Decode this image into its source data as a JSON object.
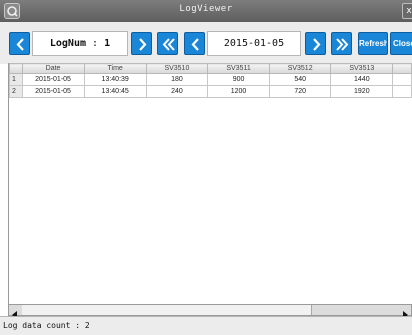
{
  "window": {
    "title": "LogViewer",
    "close_glyph": "x",
    "app_icon": "q-icon"
  },
  "toolbar": {
    "lognum_label": "LogNum",
    "lognum_sep": ":",
    "lognum_value": "1",
    "date_value": "2015-01-05",
    "refresh_label": "Refresh",
    "close_label": "Close",
    "accent_color": "#1a86d8"
  },
  "grid": {
    "columns": [
      "Date",
      "Time",
      "SV3510",
      "SV3511",
      "SV3512",
      "SV3513"
    ],
    "rows": [
      {
        "num": "1",
        "cells": [
          "2015-01-05",
          "13:40:39",
          "180",
          "900",
          "540",
          "1440"
        ]
      },
      {
        "num": "2",
        "cells": [
          "2015-01-05",
          "13:40:45",
          "240",
          "1200",
          "720",
          "1920"
        ]
      }
    ]
  },
  "status": {
    "text": "Log data count : 2"
  }
}
